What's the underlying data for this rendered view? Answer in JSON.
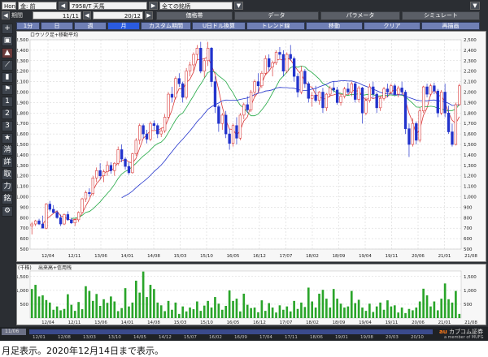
{
  "toolbar": {
    "mode": "Hon",
    "account": "金: 前",
    "ticker": "7958/T 天馬",
    "scope": "全ての銘柄",
    "period_label": "期間",
    "from_date": "11/11",
    "to_date": "20/12",
    "menu_tabs": [
      "価格帯",
      "データ",
      "パラメータ",
      "シミュレート"
    ],
    "period_buttons": [
      "1分",
      "日",
      "週",
      "月"
    ],
    "active_period": 3,
    "tools": [
      "カスタム期間",
      "U日ドル換算",
      "トレンド線",
      "移動",
      "クリア",
      "再描画"
    ]
  },
  "side_icons": [
    "plus-icon",
    "camera-icon",
    "chart-icon",
    "line-icon",
    "candle-icon",
    "flag-icon",
    "num-1-icon",
    "num-2-icon",
    "num-3-icon",
    "star-icon"
  ],
  "side_labels": [
    "消",
    "詳",
    "取",
    "力",
    "銘"
  ],
  "main_chart": {
    "title": "ロウソク足+移動平均",
    "y_ticks": [
      "2,500",
      "2,400",
      "2,300",
      "2,200",
      "2,100",
      "2,000",
      "1,900",
      "1,800",
      "1,700",
      "1,600",
      "1,500",
      "1,400",
      "1,300",
      "1,200",
      "1,100",
      "1,000",
      "900",
      "800",
      "700",
      "600",
      "500"
    ],
    "x_ticks": [
      "12/04",
      "12/11",
      "13/06",
      "14/01",
      "14/08",
      "15/03",
      "15/10",
      "16/05",
      "16/12",
      "17/07",
      "18/02",
      "18/09",
      "19/04",
      "19/11",
      "20/06",
      "21/01",
      "21/08"
    ]
  },
  "volume_chart": {
    "title": "出来高+信用残",
    "unit": "(千株)",
    "y_ticks": [
      "1,500",
      "1,000",
      "500"
    ],
    "x_ticks": [
      "12/04",
      "12/11",
      "13/06",
      "14/01",
      "14/08",
      "15/03",
      "15/10",
      "16/05",
      "16/12",
      "17/07",
      "18/02",
      "18/09",
      "19/04",
      "19/11",
      "20/06",
      "21/01",
      "21/08"
    ]
  },
  "timeline": {
    "left_label": "11/06",
    "ticks": [
      "12/01",
      "12/08",
      "13/03",
      "13/10",
      "14/05",
      "14/12",
      "15/07",
      "16/02",
      "16/09",
      "17/04",
      "17/11",
      "18/06",
      "19/01",
      "19/08",
      "20/03",
      "20/10"
    ],
    "brand": "カブコム証券",
    "brand_sub": "a member of MUFG"
  },
  "caption": "月足表示。2020年12月14日まで表示。",
  "colors": {
    "up": "#d93a3a",
    "down": "#2233cc",
    "ma_short": "#d93a3a",
    "ma_mid": "#22a844",
    "ma_long": "#2233cc",
    "volume": "#2aa52a",
    "panel_bg": "#f7f7f7"
  },
  "chart_data": [
    {
      "type": "candlestick",
      "title": "ロウソク足+移動平均",
      "ylim": [
        500,
        2500
      ],
      "x_start": "2011-11",
      "ohlc": [
        [
          720,
          760,
          640,
          740
        ],
        [
          740,
          780,
          720,
          770
        ],
        [
          770,
          790,
          730,
          740
        ],
        [
          740,
          820,
          700,
          700
        ],
        [
          700,
          940,
          690,
          930
        ],
        [
          930,
          960,
          860,
          880
        ],
        [
          880,
          920,
          840,
          850
        ],
        [
          850,
          870,
          790,
          800
        ],
        [
          800,
          830,
          720,
          740
        ],
        [
          740,
          840,
          730,
          830
        ],
        [
          830,
          860,
          770,
          780
        ],
        [
          780,
          800,
          740,
          750
        ],
        [
          750,
          790,
          720,
          780
        ],
        [
          780,
          860,
          760,
          850
        ],
        [
          850,
          990,
          840,
          980
        ],
        [
          980,
          1060,
          950,
          1040
        ],
        [
          1040,
          1080,
          1000,
          1030
        ],
        [
          1030,
          1200,
          1010,
          1180
        ],
        [
          1180,
          1280,
          1140,
          1250
        ],
        [
          1250,
          1320,
          1170,
          1200
        ],
        [
          1200,
          1260,
          1140,
          1240
        ],
        [
          1240,
          1340,
          1200,
          1300
        ],
        [
          1300,
          1330,
          1220,
          1250
        ],
        [
          1250,
          1330,
          1200,
          1320
        ],
        [
          1320,
          1480,
          1300,
          1450
        ],
        [
          1450,
          1500,
          1330,
          1360
        ],
        [
          1360,
          1380,
          1260,
          1290
        ],
        [
          1290,
          1330,
          1210,
          1230
        ],
        [
          1230,
          1420,
          1220,
          1410
        ],
        [
          1410,
          1560,
          1390,
          1540
        ],
        [
          1540,
          1700,
          1500,
          1680
        ],
        [
          1680,
          1700,
          1560,
          1600
        ],
        [
          1600,
          1640,
          1510,
          1550
        ],
        [
          1550,
          1720,
          1530,
          1700
        ],
        [
          1700,
          1730,
          1640,
          1680
        ],
        [
          1680,
          1700,
          1560,
          1600
        ],
        [
          1600,
          1660,
          1570,
          1630
        ],
        [
          1630,
          1790,
          1610,
          1760
        ],
        [
          1760,
          2000,
          1740,
          1980
        ],
        [
          1980,
          2050,
          1900,
          1950
        ],
        [
          1950,
          2150,
          1930,
          2130
        ],
        [
          2130,
          2180,
          2050,
          2080
        ],
        [
          2080,
          2100,
          1900,
          1950
        ],
        [
          1950,
          2230,
          1930,
          2200
        ],
        [
          2200,
          2290,
          2150,
          2260
        ],
        [
          2260,
          2380,
          2200,
          2360
        ],
        [
          2360,
          2450,
          2300,
          2420
        ],
        [
          2420,
          2480,
          2180,
          2200
        ],
        [
          2200,
          2320,
          2140,
          2300
        ],
        [
          2300,
          2480,
          2250,
          2420
        ],
        [
          2420,
          2430,
          2050,
          2100
        ],
        [
          2100,
          2150,
          1800,
          1860
        ],
        [
          1860,
          1880,
          1620,
          1700
        ],
        [
          1700,
          1800,
          1640,
          1780
        ],
        [
          1780,
          1820,
          1560,
          1600
        ],
        [
          1600,
          1650,
          1450,
          1510
        ],
        [
          1510,
          1700,
          1480,
          1680
        ],
        [
          1680,
          1760,
          1500,
          1560
        ],
        [
          1560,
          1800,
          1540,
          1780
        ],
        [
          1780,
          1900,
          1740,
          1880
        ],
        [
          1880,
          1960,
          1800,
          1830
        ],
        [
          1830,
          2020,
          1810,
          2000
        ],
        [
          2000,
          2120,
          1950,
          2100
        ],
        [
          2100,
          2180,
          2000,
          2060
        ],
        [
          2060,
          2200,
          2040,
          2180
        ],
        [
          2180,
          2350,
          2160,
          2320
        ],
        [
          2320,
          2360,
          2200,
          2240
        ],
        [
          2240,
          2300,
          2150,
          2280
        ],
        [
          2280,
          2400,
          2260,
          2380
        ],
        [
          2380,
          2430,
          2320,
          2360
        ],
        [
          2360,
          2400,
          2150,
          2200
        ],
        [
          2200,
          2380,
          2180,
          2360
        ],
        [
          2360,
          2450,
          2300,
          2320
        ],
        [
          2320,
          2340,
          2100,
          2150
        ],
        [
          2150,
          2180,
          1950,
          2000
        ],
        [
          2000,
          2250,
          1980,
          2200
        ],
        [
          2200,
          2220,
          2040,
          2080
        ],
        [
          2080,
          2100,
          1900,
          1940
        ],
        [
          1940,
          2000,
          1860,
          1970
        ],
        [
          1970,
          2060,
          1900,
          1920
        ],
        [
          1920,
          2010,
          1880,
          2000
        ],
        [
          2000,
          2040,
          1800,
          1850
        ],
        [
          1850,
          1990,
          1820,
          1980
        ],
        [
          1980,
          2060,
          1950,
          2040
        ],
        [
          2040,
          2100,
          2000,
          2020
        ],
        [
          2020,
          2050,
          1880,
          1900
        ],
        [
          1900,
          1980,
          1870,
          1960
        ],
        [
          1960,
          2050,
          1940,
          2030
        ],
        [
          2030,
          2090,
          1980,
          2000
        ],
        [
          2000,
          2100,
          1960,
          2080
        ],
        [
          2080,
          2100,
          1900,
          1930
        ],
        [
          1930,
          2060,
          1900,
          2040
        ],
        [
          2040,
          2050,
          1700,
          1800
        ],
        [
          1800,
          1950,
          1780,
          1920
        ],
        [
          1920,
          2080,
          1900,
          2050
        ],
        [
          2050,
          2100,
          1940,
          1980
        ],
        [
          1980,
          2000,
          1800,
          1850
        ],
        [
          1850,
          1960,
          1820,
          1940
        ],
        [
          1940,
          2050,
          1920,
          2030
        ],
        [
          2030,
          2080,
          1950,
          2000
        ],
        [
          2000,
          2080,
          1980,
          2060
        ],
        [
          2060,
          2080,
          1960,
          1980
        ],
        [
          1980,
          2060,
          1950,
          2040
        ],
        [
          2040,
          2100,
          1980,
          2000
        ],
        [
          2000,
          2020,
          1600,
          1650
        ],
        [
          1650,
          1700,
          1380,
          1500
        ],
        [
          1500,
          1750,
          1480,
          1700
        ],
        [
          1700,
          1720,
          1500,
          1540
        ],
        [
          1540,
          1850,
          1520,
          1820
        ],
        [
          1820,
          2060,
          1800,
          2050
        ],
        [
          2050,
          2080,
          1950,
          1980
        ],
        [
          1980,
          2080,
          1960,
          2060
        ],
        [
          2060,
          2090,
          1980,
          2010
        ],
        [
          2010,
          2030,
          1760,
          1800
        ],
        [
          1800,
          2020,
          1780,
          2000
        ],
        [
          2000,
          2080,
          1760,
          1800
        ],
        [
          1800,
          1870,
          1600,
          1620
        ],
        [
          1620,
          1700,
          1480,
          1500
        ],
        [
          1500,
          1900,
          1490,
          1880
        ],
        [
          1880,
          2080,
          1870,
          2060
        ]
      ],
      "ma_periods": [
        "short",
        "mid",
        "long"
      ]
    },
    {
      "type": "bar",
      "title": "出来高+信用残",
      "unit": "(千株)",
      "ylim": [
        0,
        1700
      ],
      "values": [
        1050,
        1200,
        780,
        820,
        650,
        560,
        300,
        420,
        280,
        330,
        860,
        480,
        260,
        580,
        320,
        1150,
        980,
        620,
        870,
        440,
        680,
        550,
        780,
        600,
        250,
        360,
        1080,
        420,
        560,
        1350,
        920,
        1680,
        760,
        1200,
        1050,
        560,
        460,
        250,
        620,
        300,
        560,
        150,
        420,
        240,
        380,
        320,
        600,
        260,
        450,
        620,
        380,
        760,
        520,
        300,
        440,
        1000,
        620,
        700,
        240,
        880,
        480,
        360,
        380,
        210,
        640,
        260,
        540,
        380,
        200,
        460,
        300,
        420,
        240,
        620,
        330,
        560,
        400,
        1100,
        600,
        380,
        880,
        1020,
        700,
        380,
        1050,
        700,
        520,
        380,
        420,
        980,
        540,
        660,
        380,
        260,
        520,
        220,
        420,
        560,
        300,
        640,
        420,
        460,
        200,
        380,
        180,
        330,
        280,
        380,
        600,
        1060,
        820,
        420,
        600,
        280,
        700,
        1250,
        680,
        560,
        980,
        150
      ]
    }
  ]
}
